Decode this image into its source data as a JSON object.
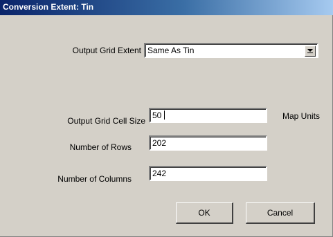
{
  "window": {
    "title": "Conversion Extent: Tin"
  },
  "form": {
    "extent_label": "Output Grid Extent",
    "extent_value": "Same As Tin",
    "cell_size_label": "Output Grid Cell Size",
    "cell_size_value": "50",
    "cell_size_units": "Map Units",
    "rows_label": "Number of Rows",
    "rows_value": "202",
    "columns_label": "Number of Columns",
    "columns_value": "242"
  },
  "buttons": {
    "ok_label": "OK",
    "cancel_label": "Cancel"
  },
  "icons": {
    "dropdown": "chevron-down-icon"
  },
  "colors": {
    "titlebar_start": "#0a246a",
    "titlebar_end": "#a6caf0",
    "dialog_face": "#d4d0c8"
  }
}
